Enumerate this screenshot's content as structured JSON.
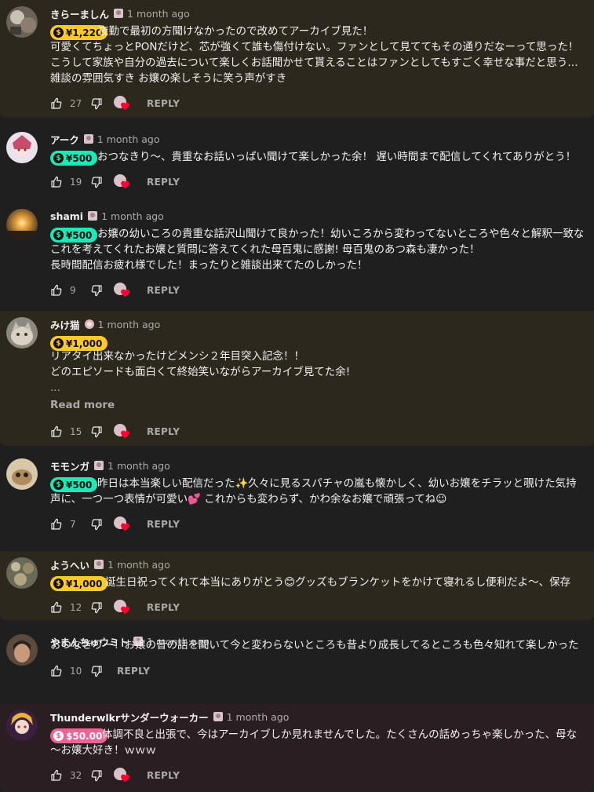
{
  "colors": {
    "gold": "#ffca28",
    "teal": "#1de9b6",
    "pink": "#f06292",
    "heart": "#ff0033",
    "text_primary": "#f1f1f1",
    "text_secondary": "#aaaaaa"
  },
  "ui": {
    "reply_label": "REPLY",
    "read_more_label": "Read more"
  },
  "comments": [
    {
      "author": "きらーましん",
      "time": "1 month ago",
      "super_thanks": "¥1,220",
      "lines": [
        "夜勤で最初の方聞けなかったので改めてアーカイブ見た！",
        "可愛くてちょっとPONだけど、芯が強くて誰も傷付けない。ファンとして見ててもその通りだなーって思った！",
        "こうして家族や自分の過去について楽しくお話聞かせて貰えることはファンとしてもすごく幸せな事だと思う…",
        "雑談の雰囲気すき お嬢の楽しそうに笑う声がすき"
      ],
      "likes": "27"
    },
    {
      "author": "アーク",
      "time": "1 month ago",
      "super_thanks": "¥500",
      "lines": [
        "おつなきり〜、貴重なお話いっぱい聞けて楽しかった余！ 遅い時間まで配信してくれてありがとう！"
      ],
      "likes": "19"
    },
    {
      "author": "shami",
      "time": "1 month ago",
      "super_thanks": "¥500",
      "lines": [
        "お嬢の幼いころの貴重な話沢山聞けて良かった！幼いころから変わってないところや色々と解釈一致な",
        "これを考えてくれたお嬢と質問に答えてくれた母百鬼に感謝! 母百鬼のあつ森も凄かった！",
        "長時間配信お疲れ様でした！まったりと雑談出来てたのしかった！"
      ],
      "likes": "9"
    },
    {
      "author": "みけ猫",
      "time": "1 month ago",
      "super_thanks": "¥1,000",
      "lines": [
        "リアタイ出来なかったけどメンシ２年目突入記念！！",
        "どのエピソードも面白くて終始笑いながらアーカイブ見てた余!",
        "..."
      ],
      "likes": "15"
    },
    {
      "author": "モモンガ",
      "time": "1 month ago",
      "super_thanks": "¥500",
      "lines": [
        "昨日は本当楽しい配信だった✨久々に見るスパチャの嵐も懐かしく、幼いお嬢をチラッと覗けた気持",
        "声に、一つ一つ表情が可愛い💕 これからも変わらず、かわ余なお嬢で頑張ってね☺"
      ],
      "likes": "7"
    },
    {
      "author": "ようへい",
      "time": "1 month ago",
      "super_thanks": "¥1,000",
      "lines": [
        "誕生日祝ってくれて本当にありがとう😊グッズもブランケットをかけて寝れるし便利だよ〜、保存"
      ],
      "likes": "12"
    },
    {
      "author": "やまんちゅウミト",
      "time": "1 month ago",
      "lines": [
        "おつなきりー！お嬢の昔の話を聞いて今と変わらないところも昔より成長してるところも色々知れて楽しかった"
      ],
      "likes": "10"
    },
    {
      "author": "Thunderwlkrサンダーウォーカー",
      "time": "1 month ago",
      "super_thanks": "$50.00",
      "lines": [
        "体調不良と出張で、今はアーカイブしか見れませんでした。たくさんの話めっちゃ楽しかった、母な",
        "〜お嬢大好き！ｗｗｗ"
      ],
      "likes": "32"
    }
  ]
}
